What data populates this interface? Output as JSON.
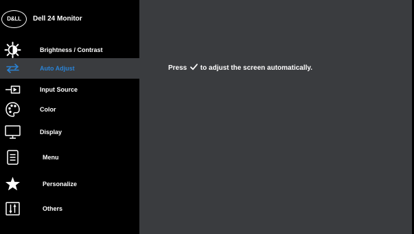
{
  "osd": {
    "logo_text": "D&LL",
    "product_name": "Dell 24 Monitor"
  },
  "menu": {
    "items": [
      {
        "label": "Brightness / Contrast",
        "icon": "brightness-icon",
        "selected": false
      },
      {
        "label": "Auto Adjust",
        "icon": "auto-adjust-icon",
        "selected": true
      },
      {
        "label": "Input Source",
        "icon": "input-source-icon",
        "selected": false
      },
      {
        "label": "Color",
        "icon": "color-palette-icon",
        "selected": false
      },
      {
        "label": "Display",
        "icon": "display-monitor-icon",
        "selected": false
      },
      {
        "label": "Menu",
        "icon": "menu-document-icon",
        "selected": false
      },
      {
        "label": "Personalize",
        "icon": "star-icon",
        "selected": false
      },
      {
        "label": "Others",
        "icon": "others-sliders-icon",
        "selected": false
      }
    ]
  },
  "content": {
    "hint_before": "Press",
    "hint_icon": "checkmark-icon",
    "hint_after": "to adjust the screen automatically."
  },
  "colors": {
    "sidebar_background": "#000000",
    "panel_background": "#3a3c3f",
    "selected_background": "#3a3c3f",
    "selected_text": "#2a83d6",
    "text": "#ffffff"
  }
}
